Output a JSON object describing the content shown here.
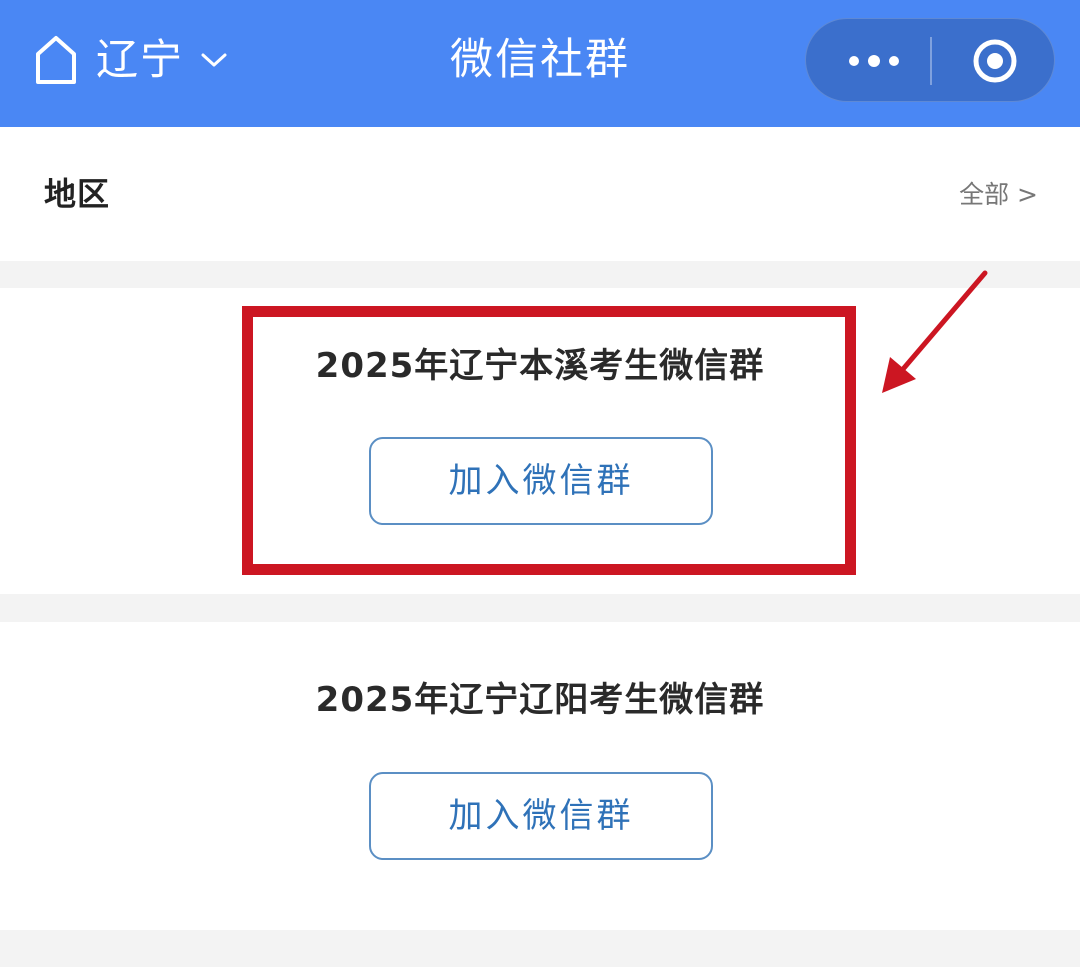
{
  "header": {
    "city": "辽宁",
    "title": "微信社群",
    "home_icon": "home-icon",
    "dropdown_icon": "chevron-down-icon",
    "more_icon": "more-dots-icon",
    "close_icon": "target-close-icon",
    "background_color": "#4a87f4"
  },
  "region": {
    "label": "地区",
    "all_link": "全部 >"
  },
  "groups": [
    {
      "title": "2025年辽宁本溪考生微信群",
      "button_label": "加入微信群"
    },
    {
      "title": "2025年辽宁辽阳考生微信群",
      "button_label": "加入微信群"
    }
  ],
  "annotation": {
    "highlight_color": "#cc1622"
  }
}
